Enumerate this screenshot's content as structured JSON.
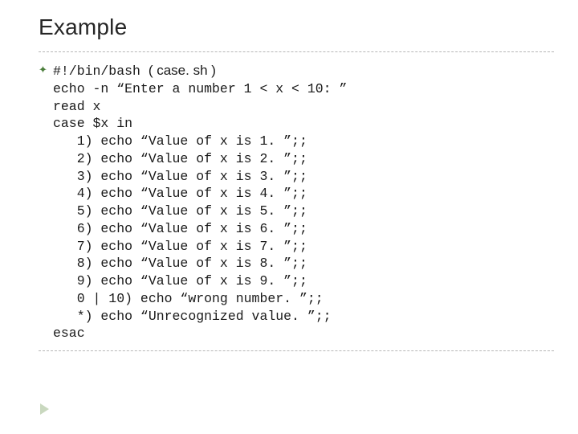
{
  "title": "Example",
  "code": {
    "l0a": "#!/bin/bash ",
    "l0b": "( case. sh )",
    "l1": "echo -n “Enter a number 1 < x < 10: ”",
    "l2": "read x",
    "l3": "case $x in",
    "c1": "   1) echo “Value of x is 1. ”;;",
    "c2": "   2) echo “Value of x is 2. ”;;",
    "c3": "   3) echo “Value of x is 3. ”;;",
    "c4": "   4) echo “Value of x is 4. ”;;",
    "c5": "   5) echo “Value of x is 5. ”;;",
    "c6": "   6) echo “Value of x is 6. ”;;",
    "c7": "   7) echo “Value of x is 7. ”;;",
    "c8": "   8) echo “Value of x is 8. ”;;",
    "c9": "   9) echo “Value of x is 9. ”;;",
    "c10": "   0 | 10) echo “wrong number. ”;;",
    "c11": "   *) echo “Unrecognized value. ”;;",
    "l_end": "esac"
  }
}
